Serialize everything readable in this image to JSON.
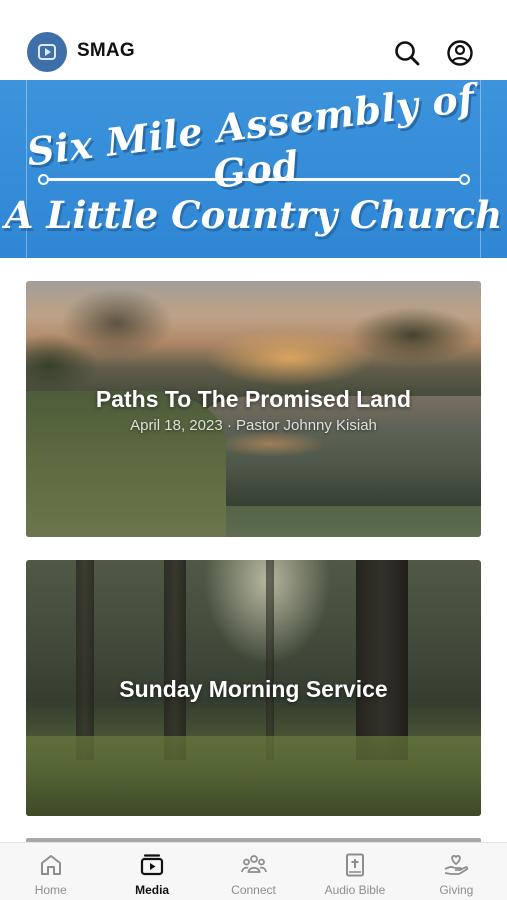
{
  "header": {
    "app_title": "SMAG",
    "logo_icon": "play-badge-icon",
    "search_icon": "search-icon",
    "profile_icon": "user-circle-icon"
  },
  "banner": {
    "line1": "Six Mile Assembly of God",
    "line2": "A Little Country Church",
    "background_color": "#3a91da"
  },
  "cards": [
    {
      "title": "Paths To The Promised Land",
      "subtitle": "April 18, 2023 · Pastor Johnny Kisiah"
    },
    {
      "title": "Sunday Morning Service"
    }
  ],
  "tabs": [
    {
      "label": "Home",
      "icon": "home-icon",
      "active": false
    },
    {
      "label": "Media",
      "icon": "media-play-icon",
      "active": true
    },
    {
      "label": "Connect",
      "icon": "people-group-icon",
      "active": false
    },
    {
      "label": "Audio Bible",
      "icon": "bible-cross-icon",
      "active": false
    },
    {
      "label": "Giving",
      "icon": "hand-heart-icon",
      "active": false
    }
  ]
}
